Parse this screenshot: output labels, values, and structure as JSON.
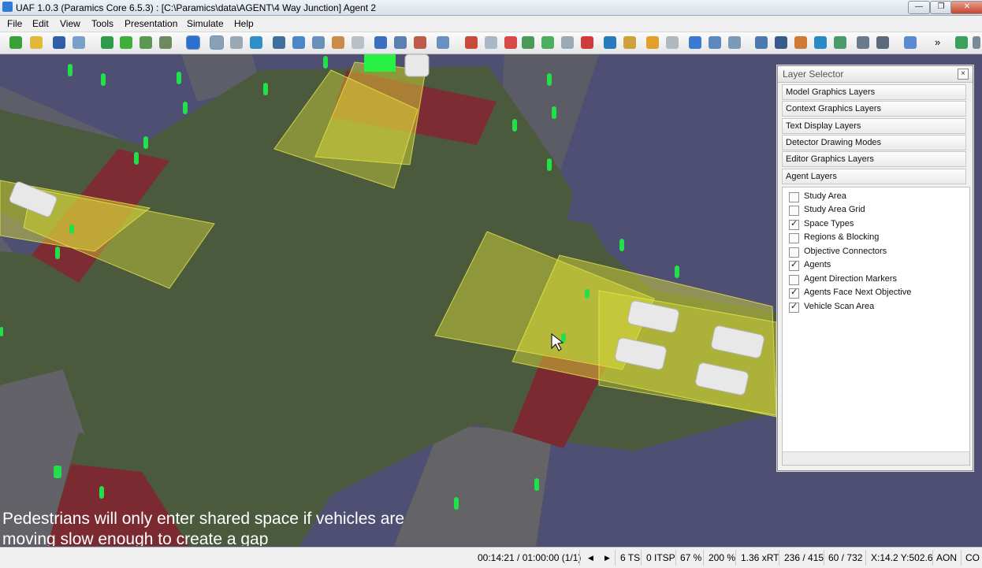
{
  "window": {
    "title": "UAF 1.0.3 (Paramics Core 6.5.3) : [C:\\Paramics\\data\\AGENT\\4 Way Junction] Agent 2",
    "minimize": "—",
    "restore": "❐",
    "close": "✕"
  },
  "menu": {
    "items": [
      "File",
      "Edit",
      "View",
      "Tools",
      "Presentation",
      "Simulate",
      "Help"
    ]
  },
  "toolbar": {
    "overflow": "»"
  },
  "viewport": {
    "caption_line1": "Pedestrians will only enter shared space if vehicles are",
    "caption_line2": "moving slow enough to create a gap"
  },
  "layer_selector": {
    "title": "Layer Selector",
    "close": "×",
    "categories": [
      "Model Graphics Layers",
      "Context Graphics Layers",
      "Text Display Layers",
      "Detector Drawing Modes",
      "Editor Graphics Layers",
      "Agent Layers"
    ],
    "layers": [
      {
        "label": "Study Area",
        "checked": false
      },
      {
        "label": "Study Area Grid",
        "checked": false
      },
      {
        "label": "Space Types",
        "checked": true
      },
      {
        "label": "Regions & Blocking",
        "checked": false
      },
      {
        "label": "Objective Connectors",
        "checked": false
      },
      {
        "label": "Agents",
        "checked": true
      },
      {
        "label": "Agent Direction Markers",
        "checked": false
      },
      {
        "label": "Agents Face Next Objective",
        "checked": true
      },
      {
        "label": "Vehicle Scan Area",
        "checked": true
      }
    ],
    "check_mark": "✓"
  },
  "status": {
    "time": "00:14:21 / 01:00:00 (1/1)",
    "prev": "◀",
    "next": "▶",
    "ts": "6 TS",
    "itsp": "0 ITSP",
    "zoom1": "67 %",
    "zoom2": "200 %",
    "speed": "1.36 xRT",
    "count1": "236 / 415",
    "count2": "60 / 732",
    "coords": "X:14.2  Y:502.6",
    "mode1": "AON",
    "mode2": "CO"
  },
  "colors": {
    "ground": "#4e4f72",
    "junction": "#4a5a3c",
    "crossing": "#8a2a2a",
    "scan": "#e7e83a",
    "agent": "#22e04a",
    "vehicle": "#e6e6e6"
  }
}
